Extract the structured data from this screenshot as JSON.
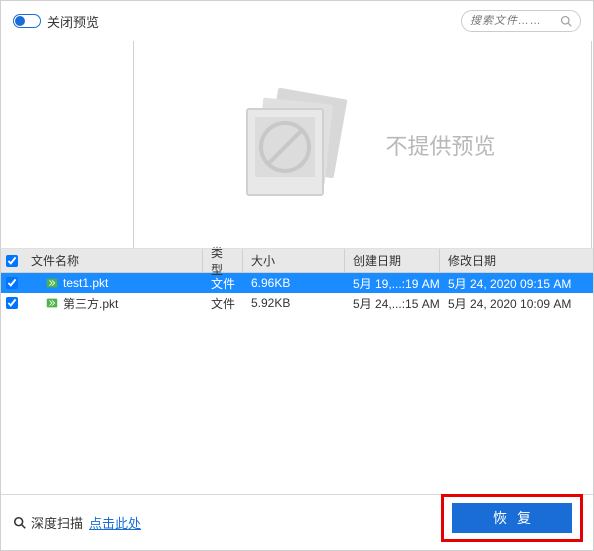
{
  "header": {
    "toggle_label": "关闭预览",
    "search_placeholder": "搜索文件……"
  },
  "preview": {
    "no_preview_text": "不提供预览"
  },
  "table": {
    "columns": {
      "name": "文件名称",
      "type": "类型",
      "size": "大小",
      "created": "创建日期",
      "modified": "修改日期"
    },
    "rows": [
      {
        "checked": true,
        "selected": true,
        "name": "test1.pkt",
        "type": "文件",
        "size": "6.96KB",
        "created": "5月 19,...:19 AM",
        "modified": "5月 24, 2020 09:15 AM"
      },
      {
        "checked": true,
        "selected": false,
        "name": "第三方.pkt",
        "type": "文件",
        "size": "5.92KB",
        "created": "5月 24,...:15 AM",
        "modified": "5月 24, 2020 10:09 AM"
      }
    ],
    "header_checked": true
  },
  "footer": {
    "deep_scan_label": "深度扫描",
    "deep_scan_link": "点击此处",
    "recover_button": "恢复"
  }
}
